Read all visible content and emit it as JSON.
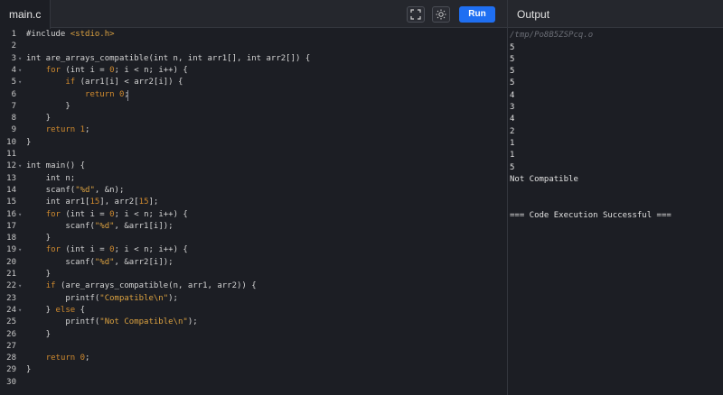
{
  "tab": {
    "label": "main.c"
  },
  "toolbar": {
    "run_label": "Run",
    "fullscreen_icon": "fullscreen-icon",
    "theme_icon": "sun-icon"
  },
  "output": {
    "title": "Output",
    "path": "/tmp/Po8B5ZSPcq.o",
    "lines": [
      "5",
      "5",
      "5",
      "5",
      "4",
      "3",
      "4",
      "2",
      "1",
      "1",
      "5",
      "Not Compatible",
      "",
      "",
      "=== Code Execution Successful ==="
    ]
  },
  "editor": {
    "lines": [
      "#include <stdio.h>",
      "",
      "int are_arrays_compatible(int n, int arr1[], int arr2[]) {",
      "    for (int i = 0; i < n; i++) {",
      "        if (arr1[i] < arr2[i]) {",
      "            return 0;",
      "        }",
      "    }",
      "    return 1;",
      "}",
      "",
      "int main() {",
      "    int n;",
      "    scanf(\"%d\", &n);",
      "    int arr1[15], arr2[15];",
      "    for (int i = 0; i < n; i++) {",
      "        scanf(\"%d\", &arr1[i]);",
      "    }",
      "    for (int i = 0; i < n; i++) {",
      "        scanf(\"%d\", &arr2[i]);",
      "    }",
      "    if (are_arrays_compatible(n, arr1, arr2)) {",
      "        printf(\"Compatible\\n\");",
      "    } else {",
      "        printf(\"Not Compatible\\n\");",
      "    }",
      "",
      "    return 0;",
      "}",
      ""
    ],
    "fold_lines": [
      3,
      4,
      5,
      12,
      16,
      19,
      22,
      24
    ]
  }
}
